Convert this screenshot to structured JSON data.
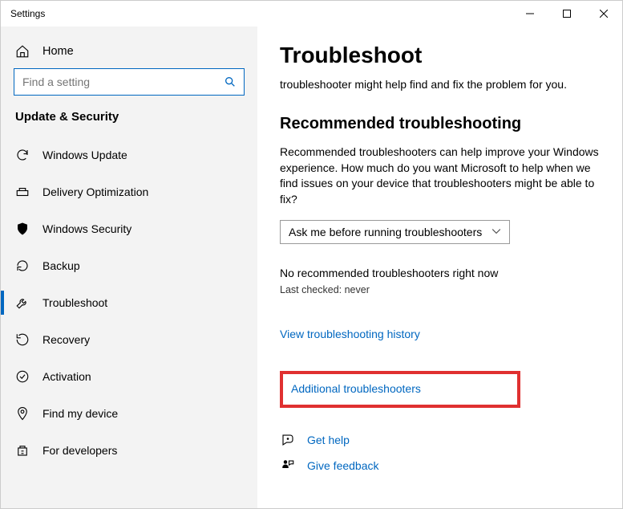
{
  "title": "Settings",
  "sidebar": {
    "home": "Home",
    "search_placeholder": "Find a setting",
    "section": "Update & Security",
    "items": [
      {
        "label": "Windows Update"
      },
      {
        "label": "Delivery Optimization"
      },
      {
        "label": "Windows Security"
      },
      {
        "label": "Backup"
      },
      {
        "label": "Troubleshoot"
      },
      {
        "label": "Recovery"
      },
      {
        "label": "Activation"
      },
      {
        "label": "Find my device"
      },
      {
        "label": "For developers"
      }
    ]
  },
  "main": {
    "heading": "Troubleshoot",
    "lead": "troubleshooter might help find and fix the problem for you.",
    "rec_heading": "Recommended troubleshooting",
    "rec_para": "Recommended troubleshooters can help improve your Windows experience. How much do you want Microsoft to help when we find issues on your device that troubleshooters might be able to fix?",
    "dropdown_value": "Ask me before running troubleshooters",
    "no_rec": "No recommended troubleshooters right now",
    "last_checked": "Last checked: never",
    "history_link": "View troubleshooting history",
    "additional_link": "Additional troubleshooters",
    "get_help": "Get help",
    "give_feedback": "Give feedback"
  }
}
